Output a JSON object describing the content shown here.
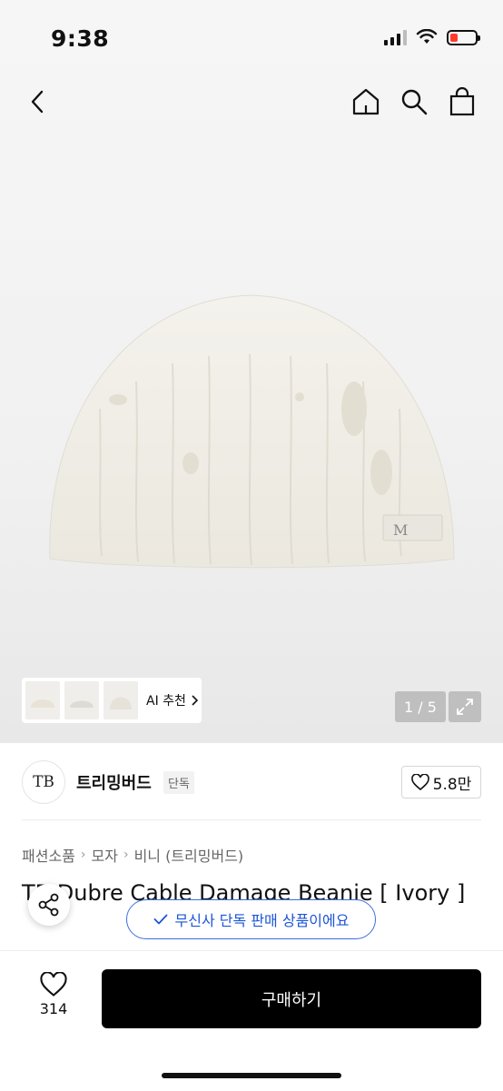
{
  "status_bar": {
    "time": "9:38",
    "icons": [
      "signal-icon",
      "wifi-icon",
      "battery-icon"
    ],
    "battery_color": "#ff3b30"
  },
  "header": {
    "icons": [
      "back-chevron-icon",
      "home-icon",
      "search-icon",
      "shopping-bag-icon"
    ]
  },
  "gallery": {
    "ai_label": "AI 추천",
    "counter": "1 / 5",
    "thumbnails": [
      "beanie-thumbnail-1",
      "beanie-thumbnail-2",
      "beanie-thumbnail-3"
    ]
  },
  "brand": {
    "logo_text": "TB",
    "name": "트리밍버드",
    "badge": "단독",
    "likes": "5.8만"
  },
  "breadcrumb": [
    "패션소품",
    "모자",
    "비니 (트리밍버드)"
  ],
  "product": {
    "title": "TB Dubre Cable Damage Beanie [ Ivory ]"
  },
  "toast": {
    "text": "무신사 단독 판매 상품이에요"
  },
  "bottom": {
    "wish_count": "314",
    "buy_label": "구매하기"
  },
  "colors": {
    "accent_blue": "#1c55d6",
    "buy_button": "#000000"
  }
}
